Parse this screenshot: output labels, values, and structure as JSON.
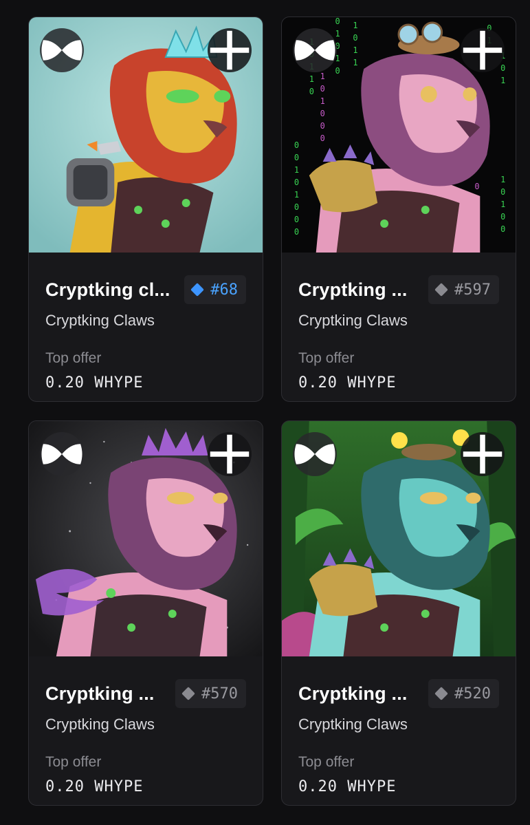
{
  "cards": [
    {
      "title": "Cryptking cl...",
      "rank": "#68",
      "rank_color": "#4aa3ff",
      "collection": "Cryptking Claws",
      "offer_label": "Top offer",
      "offer_value": "0.20 WHYPE",
      "background": "cyan-sky",
      "mane_color": "#c8432c",
      "face_color": "#e7b73a"
    },
    {
      "title": "Cryptking ...",
      "rank": "#597",
      "rank_color": "#9a9aa0",
      "collection": "Cryptking Claws",
      "offer_label": "Top offer",
      "offer_value": "0.20 WHYPE",
      "background": "matrix-code",
      "mane_color": "#8c4d80",
      "face_color": "#e8a6c3"
    },
    {
      "title": "Cryptking ...",
      "rank": "#570",
      "rank_color": "#9a9aa0",
      "collection": "Cryptking Claws",
      "offer_label": "Top offer",
      "offer_value": "0.20 WHYPE",
      "background": "dark-stars",
      "mane_color": "#7a4474",
      "face_color": "#e8a6c3"
    },
    {
      "title": "Cryptking ...",
      "rank": "#520",
      "rank_color": "#9a9aa0",
      "collection": "Cryptking Claws",
      "offer_label": "Top offer",
      "offer_value": "0.20 WHYPE",
      "background": "jungle",
      "mane_color": "#2f6b6b",
      "face_color": "#67c9c3"
    }
  ],
  "icons": {
    "collection_badge": "bow-tie-icon",
    "add": "plus-icon",
    "rank": "diamond-icon"
  }
}
